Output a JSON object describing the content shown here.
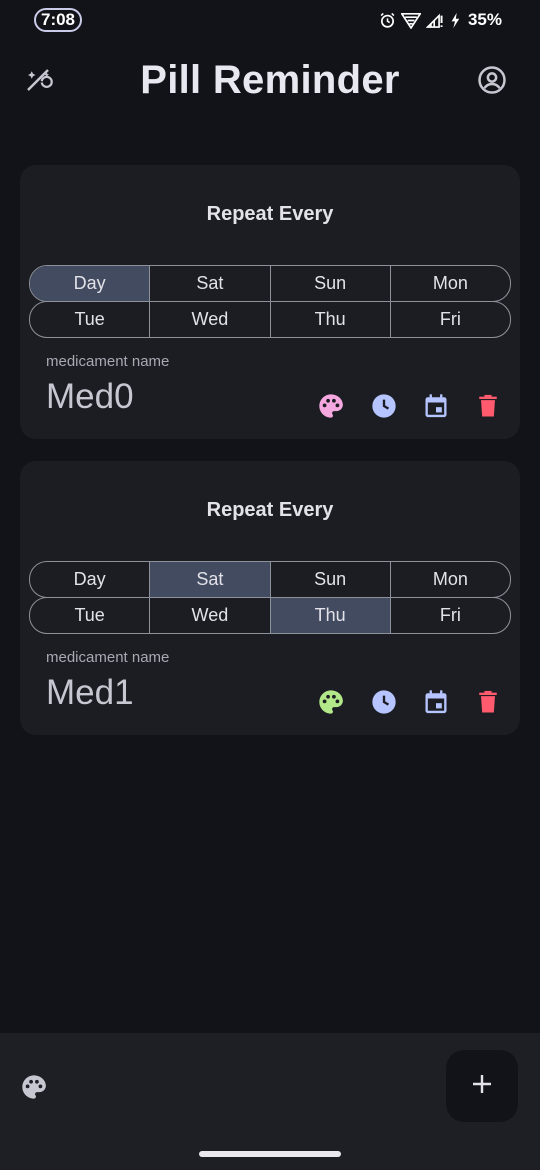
{
  "status_bar": {
    "time": "7:08",
    "battery": "35%",
    "icons": [
      "alarm-icon",
      "wifi-icon",
      "signal-icon",
      "charging-icon"
    ]
  },
  "app_bar": {
    "title": "Pill Reminder",
    "left_icon": "theme-toggle-icon",
    "right_icon": "account-circle-icon"
  },
  "cards": [
    {
      "heading": "Repeat Every",
      "days_row1": [
        {
          "label": "Day",
          "selected": true
        },
        {
          "label": "Sat",
          "selected": false
        },
        {
          "label": "Sun",
          "selected": false
        },
        {
          "label": "Mon",
          "selected": false
        }
      ],
      "days_row2": [
        {
          "label": "Tue",
          "selected": false
        },
        {
          "label": "Wed",
          "selected": false
        },
        {
          "label": "Thu",
          "selected": false
        },
        {
          "label": "Fri",
          "selected": false
        }
      ],
      "med_label": "medicament name",
      "med_name": "Med0",
      "palette_color": "#f5a8df"
    },
    {
      "heading": "Repeat Every",
      "days_row1": [
        {
          "label": "Day",
          "selected": false
        },
        {
          "label": "Sat",
          "selected": true
        },
        {
          "label": "Sun",
          "selected": false
        },
        {
          "label": "Mon",
          "selected": false
        }
      ],
      "days_row2": [
        {
          "label": "Tue",
          "selected": false
        },
        {
          "label": "Wed",
          "selected": false
        },
        {
          "label": "Thu",
          "selected": true
        },
        {
          "label": "Fri",
          "selected": false
        }
      ],
      "med_label": "medicament name",
      "med_name": "Med1",
      "palette_color": "#b2e88a"
    }
  ],
  "colors": {
    "clock": "#b6c4ff",
    "calendar": "#b6c4ff",
    "delete": "#ff5a6e",
    "selected_day": "#434b60"
  },
  "bottom_bar": {
    "left_icon": "palette-icon",
    "fab_icon": "add-icon"
  }
}
